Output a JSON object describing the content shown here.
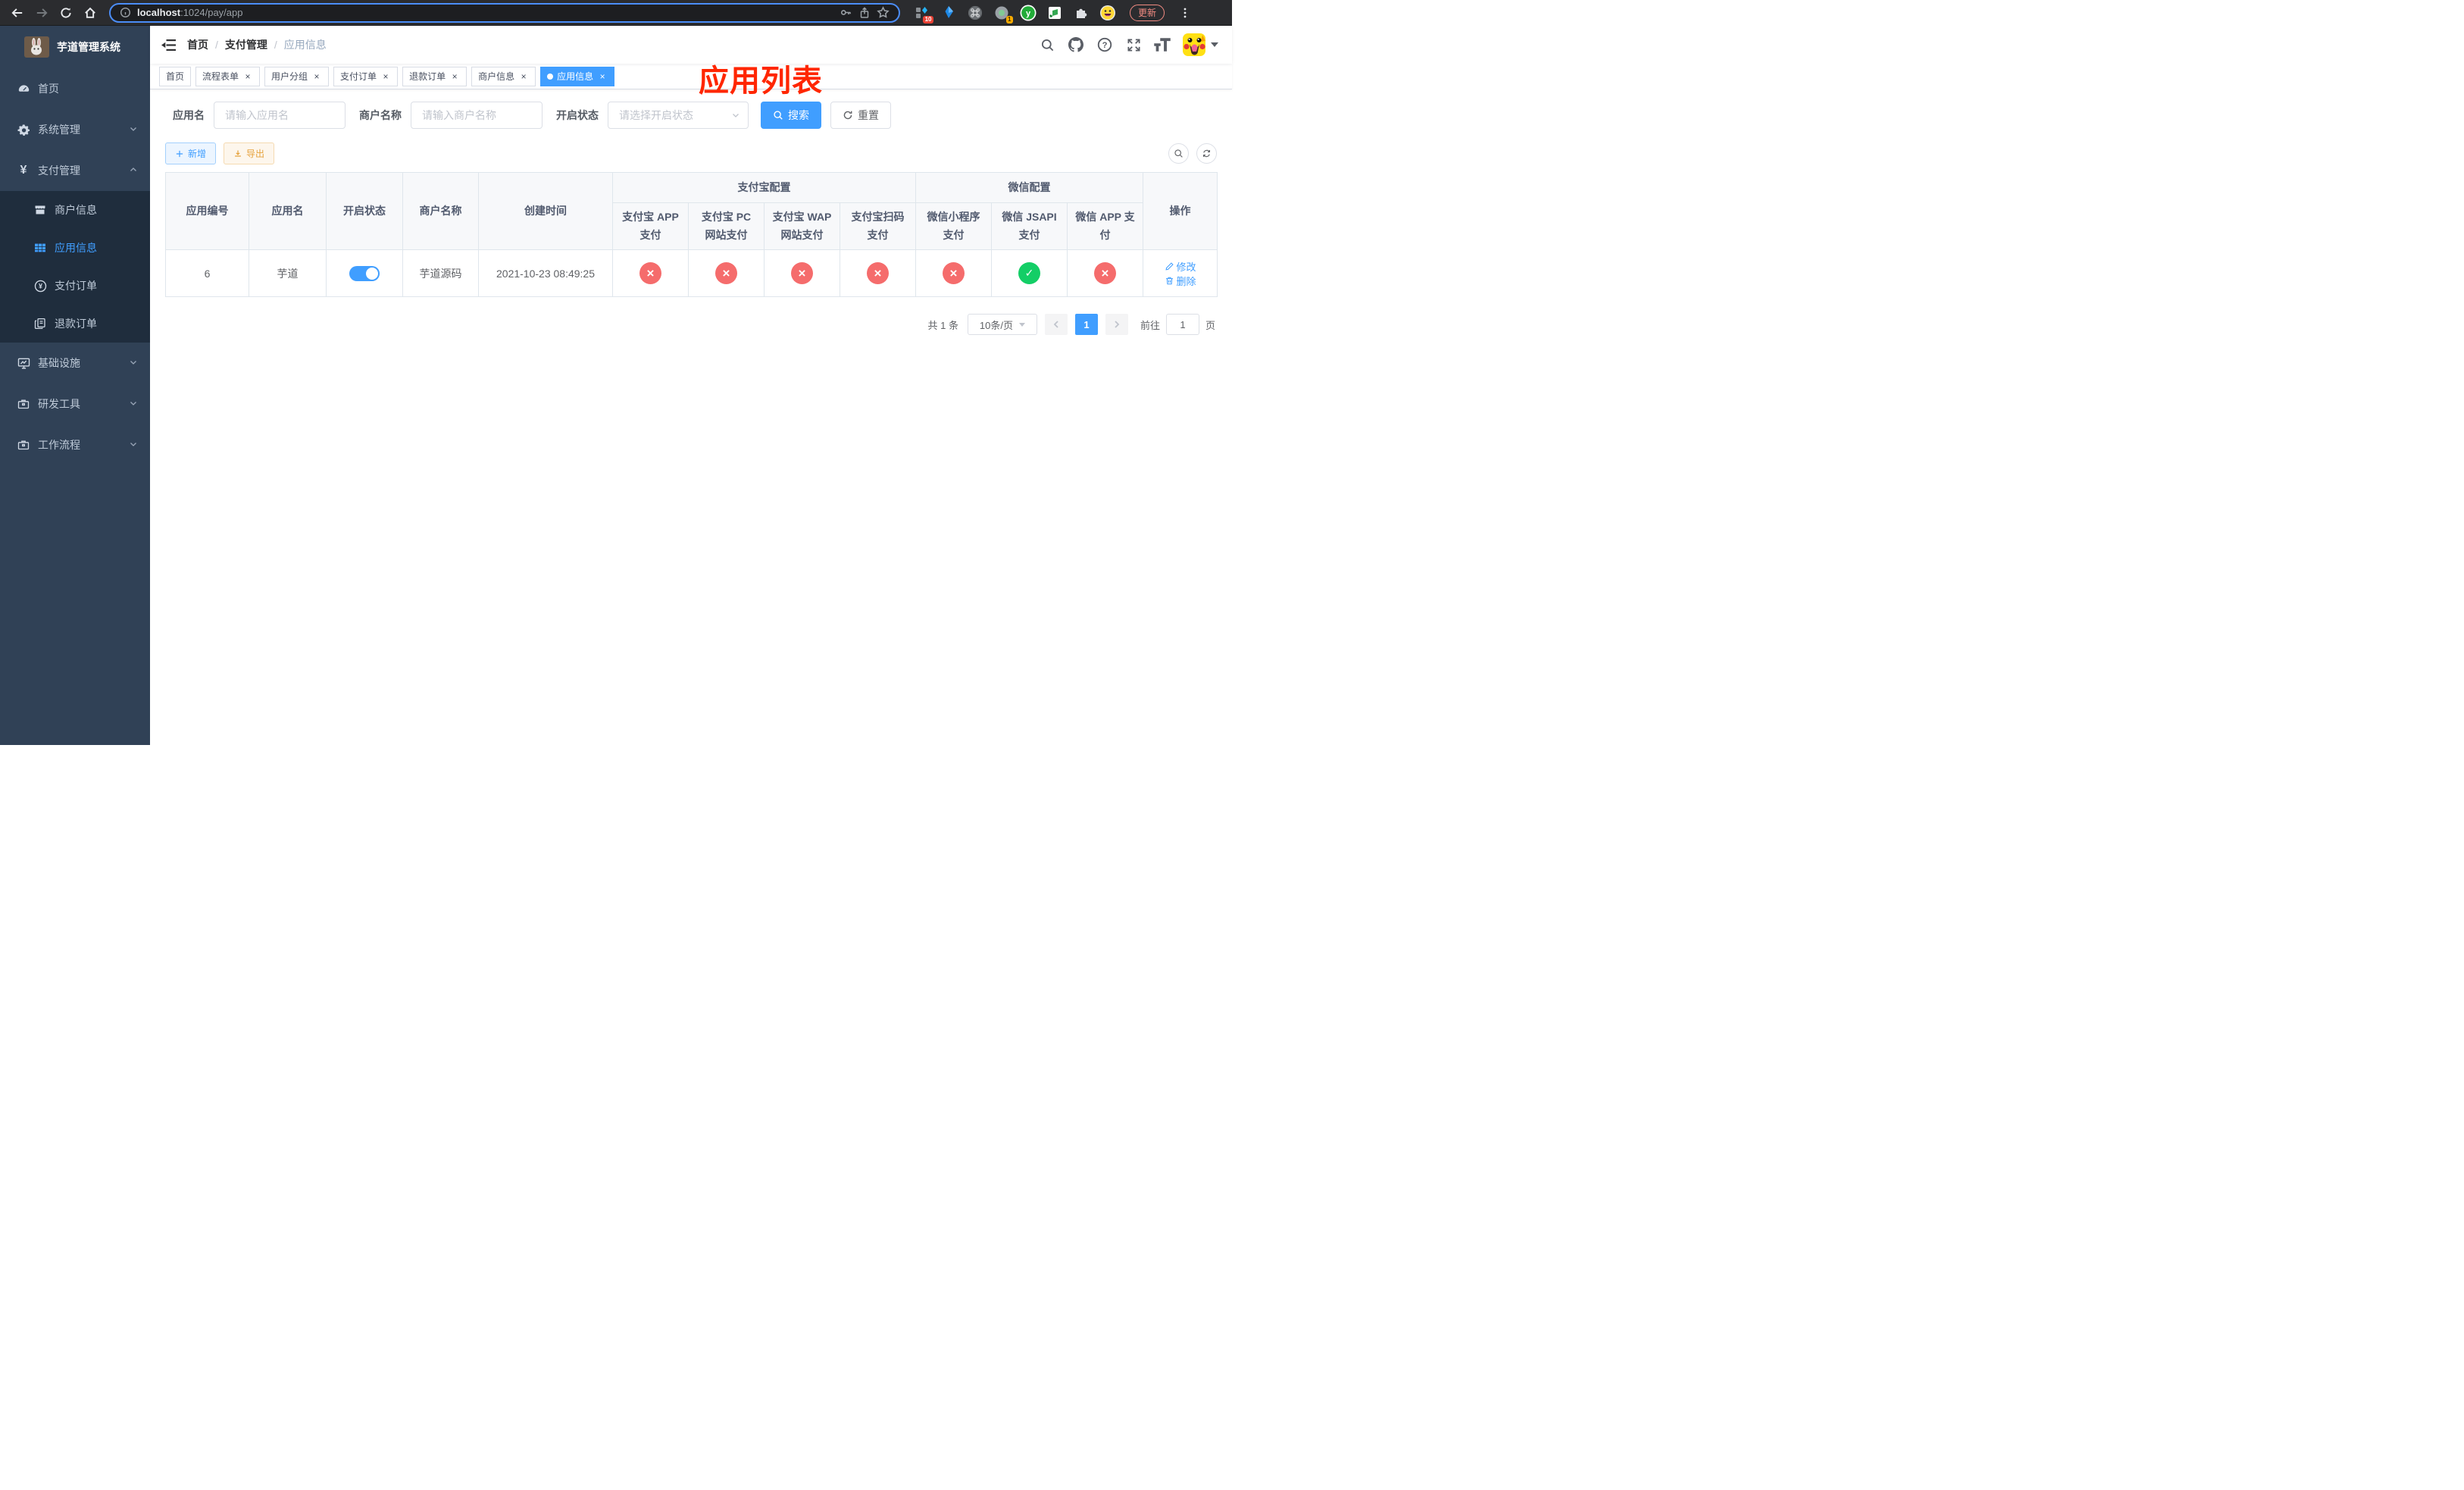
{
  "browser": {
    "url": {
      "host": "localhost",
      "rest": ":1024/pay/app"
    },
    "update_button": "更新",
    "extensions": {
      "grid_badge": "10",
      "circle_badge": "1"
    }
  },
  "annotation": {
    "text": "应用列表",
    "color": "#ff2600"
  },
  "app": {
    "title": "芋道管理系统",
    "sidebar": {
      "main_items": [
        {
          "label": "首页",
          "expandable": false
        },
        {
          "label": "系统管理",
          "expandable": true,
          "expanded": false
        },
        {
          "label": "支付管理",
          "expandable": true,
          "expanded": true
        }
      ],
      "pay_submenu": [
        {
          "label": "商户信息",
          "active": false
        },
        {
          "label": "应用信息",
          "active": true
        },
        {
          "label": "支付订单",
          "active": false
        },
        {
          "label": "退款订单",
          "active": false
        }
      ],
      "bottom_items": [
        {
          "label": "基础设施",
          "expandable": true
        },
        {
          "label": "研发工具",
          "expandable": true
        },
        {
          "label": "工作流程",
          "expandable": true
        }
      ]
    },
    "breadcrumb": {
      "items": [
        "首页",
        "支付管理",
        "应用信息"
      ],
      "separator": "/"
    },
    "tabs": [
      {
        "label": "首页",
        "closable": false,
        "active": false
      },
      {
        "label": "流程表单",
        "closable": true,
        "active": false
      },
      {
        "label": "用户分组",
        "closable": true,
        "active": false
      },
      {
        "label": "支付订单",
        "closable": true,
        "active": false
      },
      {
        "label": "退款订单",
        "closable": true,
        "active": false
      },
      {
        "label": "商户信息",
        "closable": true,
        "active": false
      },
      {
        "label": "应用信息",
        "closable": true,
        "active": true
      }
    ],
    "filters": {
      "app_name_label": "应用名",
      "app_name_placeholder": "请输入应用名",
      "merchant_label": "商户名称",
      "merchant_placeholder": "请输入商户名称",
      "status_label": "开启状态",
      "status_placeholder": "请选择开启状态",
      "search_label": "搜索",
      "reset_label": "重置"
    },
    "toolbar": {
      "add": "新增",
      "export": "导出"
    },
    "table": {
      "columns": {
        "app_id": "应用编号",
        "app_name": "应用名",
        "status": "开启状态",
        "merchant": "商户名称",
        "created": "创建时间",
        "alipay_group": "支付宝配置",
        "alipay": [
          "支付宝 APP 支付",
          "支付宝 PC 网站支付",
          "支付宝 WAP 网站支付",
          "支付宝扫码支付"
        ],
        "wechat_group": "微信配置",
        "wechat": [
          "微信小程序支付",
          "微信 JSAPI 支付",
          "微信 APP 支付"
        ],
        "actions": "操作"
      },
      "rows": [
        {
          "app_id": "6",
          "app_name": "芋道",
          "enabled": true,
          "merchant": "芋道源码",
          "created": "2021-10-23 08:49:25",
          "channels": [
            false,
            false,
            false,
            false,
            false,
            true,
            false
          ],
          "edit": "修改",
          "delete": "删除"
        }
      ]
    },
    "pagination": {
      "total": "共 1 条",
      "page_size": "10条/页",
      "page": "1",
      "goto_prefix": "前往",
      "goto_value": "1",
      "goto_suffix": "页"
    },
    "colors": {
      "accent": "#409eff",
      "success": "#13ce66",
      "danger": "#f56c6c",
      "warning": "#e6a23c",
      "annotation": "#ff2600",
      "sidebar": "#304156",
      "submenu": "#1f2d3d"
    }
  }
}
